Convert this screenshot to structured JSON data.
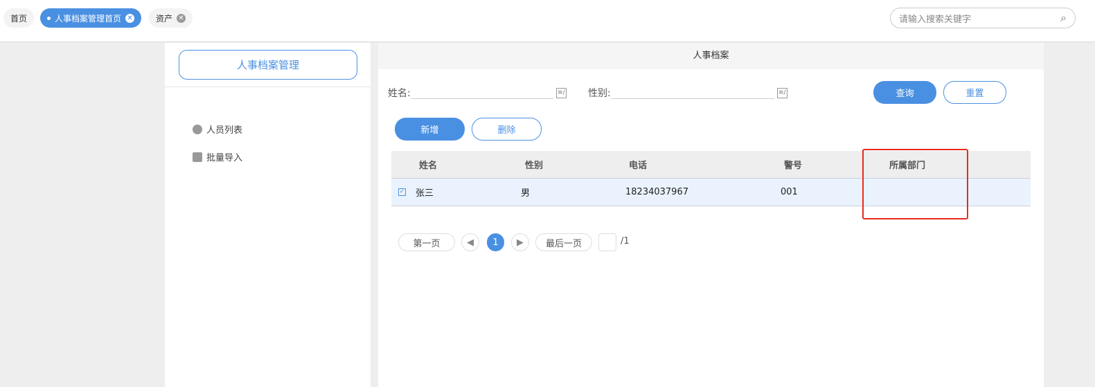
{
  "tabs": [
    {
      "label": "首页"
    },
    {
      "label": "人事档案管理首页",
      "active": true
    },
    {
      "label": "资产"
    }
  ],
  "search": {
    "placeholder": "请输入搜索关键字"
  },
  "sidebar": {
    "title": "人事档案管理",
    "items": [
      {
        "label": "人员列表",
        "icon": "list-icon"
      },
      {
        "label": "批量导入",
        "icon": "import-icon"
      }
    ]
  },
  "main": {
    "title": "人事档案",
    "filters": {
      "name_label": "姓名:",
      "gender_label": "性别:",
      "name_value": "",
      "gender_value": ""
    },
    "query_label": "查询",
    "reset_label": "重置",
    "add_label": "新增",
    "delete_label": "删除",
    "table": {
      "headers": [
        "姓名",
        "性别",
        "电话",
        "警号",
        "所属部门"
      ],
      "rows": [
        {
          "checked": true,
          "cells": [
            "张三",
            "男",
            "18234037967",
            "001",
            ""
          ]
        }
      ]
    },
    "pagination": {
      "first": "第一页",
      "last": "最后一页",
      "current": "1",
      "total": "/1",
      "page_input": ""
    }
  },
  "colors": {
    "accent": "#4a90e2",
    "highlight": "#e8291c"
  }
}
